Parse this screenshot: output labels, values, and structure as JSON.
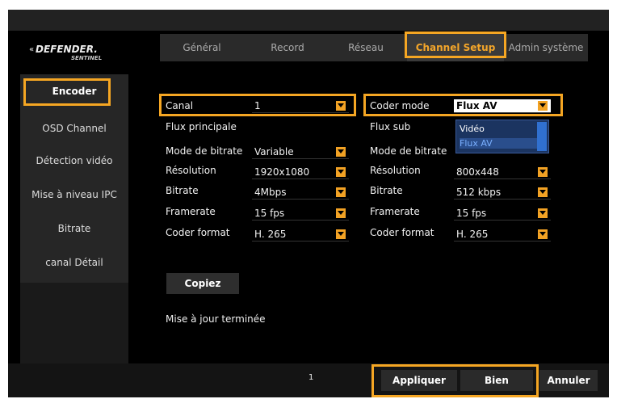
{
  "brand": {
    "name": "DEFENDER.",
    "sub": "SENTINEL"
  },
  "tabs": [
    {
      "label": "Général"
    },
    {
      "label": "Record"
    },
    {
      "label": "Réseau"
    },
    {
      "label": "Channel Setup"
    },
    {
      "label": "Admin système"
    }
  ],
  "sidebar": {
    "items": [
      {
        "label": "Encoder"
      },
      {
        "label": "OSD Channel"
      },
      {
        "label": "Détection vidéo"
      },
      {
        "label": "Mise à niveau IPC"
      },
      {
        "label": "Bitrate"
      },
      {
        "label": "canal Détail"
      }
    ]
  },
  "form": {
    "canal_label": "Canal",
    "canal_value": "1",
    "coder_mode_label": "Coder mode",
    "coder_mode_value": "Flux AV",
    "coder_mode_options": [
      "Vidéo",
      "Flux AV"
    ],
    "main": {
      "heading": "Flux principale",
      "bitrate_mode_label": "Mode de bitrate",
      "bitrate_mode_value": "Variable",
      "resolution_label": "Résolution",
      "resolution_value": "1920x1080",
      "bitrate_label": "Bitrate",
      "bitrate_value": "4Mbps",
      "framerate_label": "Framerate",
      "framerate_value": "15 fps",
      "coder_format_label": "Coder format",
      "coder_format_value": "H. 265"
    },
    "sub": {
      "heading": "Flux sub",
      "bitrate_mode_label": "Mode de bitrate",
      "resolution_label": "Résolution",
      "resolution_value": "800x448",
      "bitrate_label": "Bitrate",
      "bitrate_value": "512 kbps",
      "framerate_label": "Framerate",
      "framerate_value": "15 fps",
      "coder_format_label": "Coder format",
      "coder_format_value": "H. 265"
    }
  },
  "copy_button": "Copiez",
  "status_text": "Mise à jour terminée",
  "footer": {
    "page": "1",
    "apply": "Appliquer",
    "ok": "Bien",
    "cancel": "Annuler"
  },
  "colors": {
    "accent": "#f5a623",
    "background": "#000000",
    "dropdown": "#1b3460"
  },
  "icons": [
    "dropdown-arrow-icon"
  ]
}
